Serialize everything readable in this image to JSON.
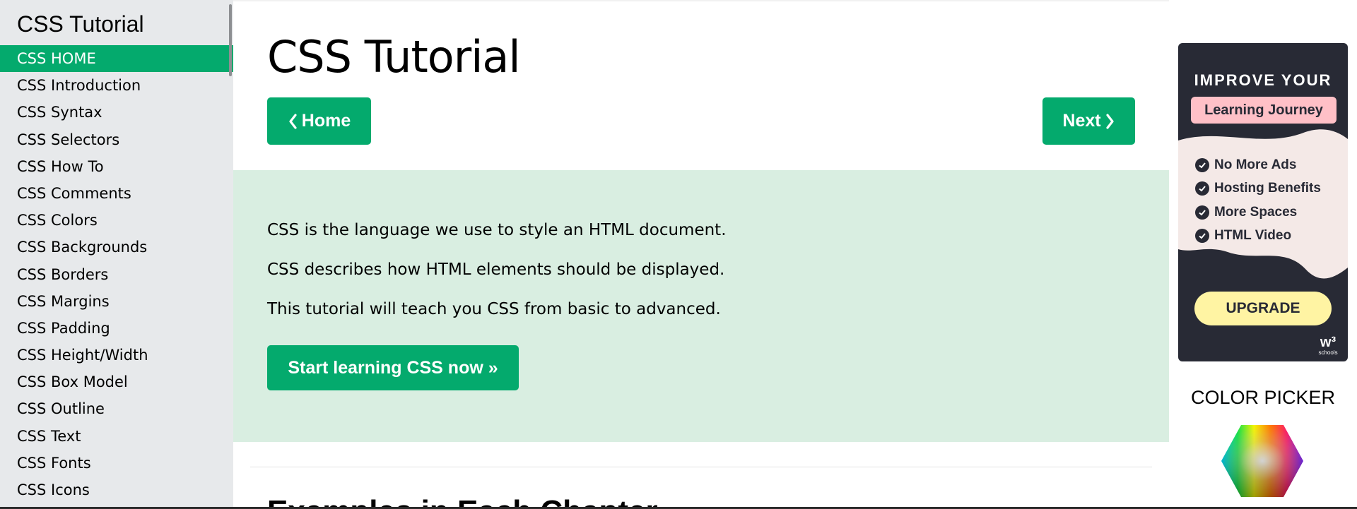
{
  "sidebar": {
    "title": "CSS Tutorial",
    "items": [
      {
        "label": "CSS HOME",
        "active": true
      },
      {
        "label": "CSS Introduction"
      },
      {
        "label": "CSS Syntax"
      },
      {
        "label": "CSS Selectors"
      },
      {
        "label": "CSS How To"
      },
      {
        "label": "CSS Comments"
      },
      {
        "label": "CSS Colors"
      },
      {
        "label": "CSS Backgrounds"
      },
      {
        "label": "CSS Borders"
      },
      {
        "label": "CSS Margins"
      },
      {
        "label": "CSS Padding"
      },
      {
        "label": "CSS Height/Width"
      },
      {
        "label": "CSS Box Model"
      },
      {
        "label": "CSS Outline"
      },
      {
        "label": "CSS Text"
      },
      {
        "label": "CSS Fonts"
      },
      {
        "label": "CSS Icons"
      }
    ]
  },
  "main": {
    "title": "CSS Tutorial",
    "nav": {
      "home_label": "Home",
      "next_label": "Next"
    },
    "intro": {
      "lines": [
        "CSS is the language we use to style an HTML document.",
        "CSS describes how HTML elements should be displayed.",
        "This tutorial will teach you CSS from basic to advanced."
      ],
      "cta_label": "Start learning CSS now »"
    },
    "next_heading": "Examples in Each Chapter"
  },
  "ad": {
    "headline": "IMPROVE YOUR",
    "pill": "Learning Journey",
    "features": [
      "No More Ads",
      "Hosting Benefits",
      "More Spaces",
      "HTML Video"
    ],
    "button_label": "UPGRADE",
    "logo_mark": "w³",
    "logo_text": "schools"
  },
  "color_picker": {
    "title": "COLOR PICKER"
  },
  "colors": {
    "accent": "#04aa6d",
    "sidebar_bg": "#e7e9eb",
    "intro_bg": "#d9eee1",
    "ad_bg": "#282a35",
    "ad_pill": "#ffc0c7",
    "ad_button": "#fff4a3"
  }
}
